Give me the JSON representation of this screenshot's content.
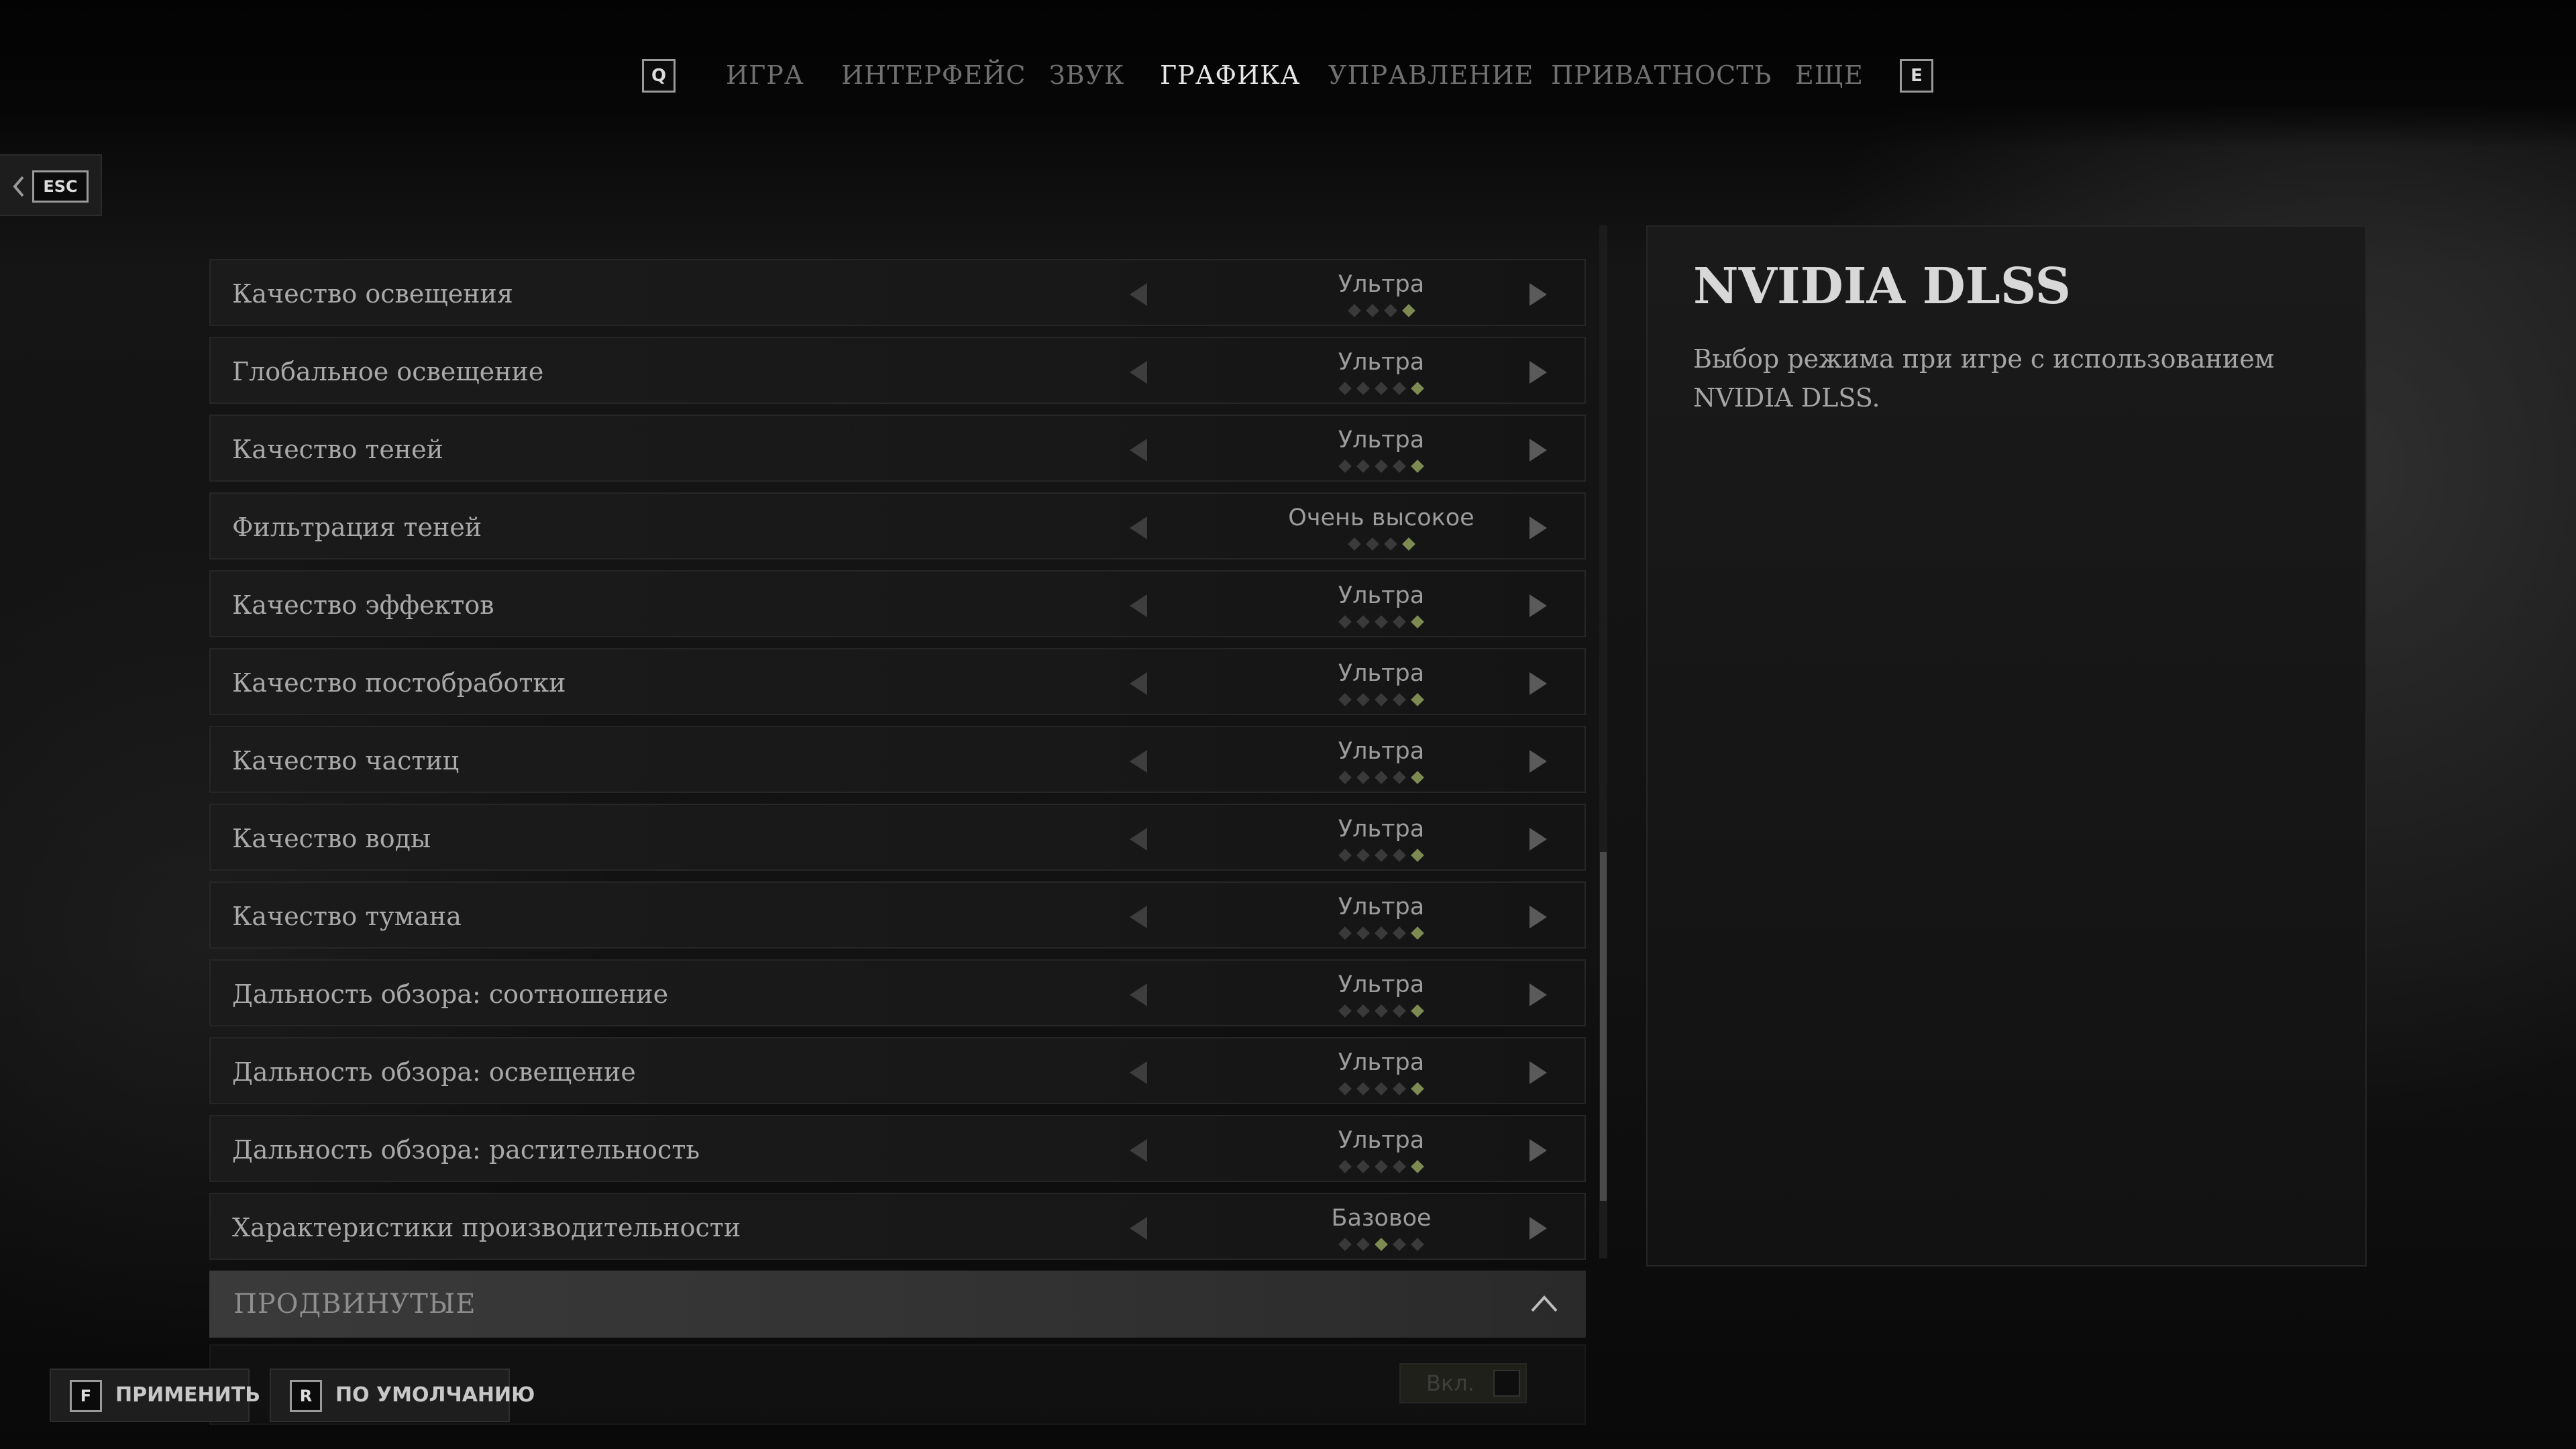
{
  "topbar": {
    "left_key": "Q",
    "right_key": "E",
    "tabs": [
      {
        "label": "ИГРА",
        "active": false
      },
      {
        "label": "ИНТЕРФЕЙС",
        "active": false
      },
      {
        "label": "ЗВУК",
        "active": false
      },
      {
        "label": "ГРАФИКА",
        "active": true
      },
      {
        "label": "УПРАВЛЕНИЕ",
        "active": false
      },
      {
        "label": "ПРИВАТНОСТЬ",
        "active": false
      },
      {
        "label": "ЕЩЕ",
        "active": false
      }
    ]
  },
  "back": {
    "key": "ESC"
  },
  "settings": [
    {
      "label": "Качество освещения",
      "value": "Ультра",
      "level": 4,
      "levels": 4
    },
    {
      "label": "Глобальное освещение",
      "value": "Ультра",
      "level": 5,
      "levels": 5
    },
    {
      "label": "Качество теней",
      "value": "Ультра",
      "level": 5,
      "levels": 5
    },
    {
      "label": "Фильтрация теней",
      "value": "Очень высокое",
      "level": 4,
      "levels": 4
    },
    {
      "label": "Качество эффектов",
      "value": "Ультра",
      "level": 5,
      "levels": 5
    },
    {
      "label": "Качество постобработки",
      "value": "Ультра",
      "level": 5,
      "levels": 5
    },
    {
      "label": "Качество частиц",
      "value": "Ультра",
      "level": 5,
      "levels": 5
    },
    {
      "label": "Качество воды",
      "value": "Ультра",
      "level": 5,
      "levels": 5
    },
    {
      "label": "Качество тумана",
      "value": "Ультра",
      "level": 5,
      "levels": 5
    },
    {
      "label": "Дальность обзора: соотношение",
      "value": "Ультра",
      "level": 5,
      "levels": 5
    },
    {
      "label": "Дальность обзора: освещение",
      "value": "Ультра",
      "level": 5,
      "levels": 5
    },
    {
      "label": "Дальность обзора: растительность",
      "value": "Ультра",
      "level": 5,
      "levels": 5
    },
    {
      "label": "Характеристики производительности",
      "value": "Базовое",
      "level": 3,
      "levels": 5
    }
  ],
  "advanced": {
    "label": "ПРОДВИНУТЫЕ"
  },
  "next_toggle": {
    "value": "Вкл."
  },
  "description": {
    "title": "NVIDIA DLSS",
    "text": "Выбор режима при игре с использованием NVIDIA DLSS."
  },
  "bottom": {
    "apply": {
      "key": "F",
      "label": "ПРИМЕНИТЬ"
    },
    "default": {
      "key": "R",
      "label": "ПО УМОЛЧАНИЮ"
    }
  },
  "colors": {
    "pip_on": "#7d8a52",
    "pip_off": "#3a3a3a",
    "active_tab": "#e6e6e6",
    "inactive_tab": "#707070"
  }
}
